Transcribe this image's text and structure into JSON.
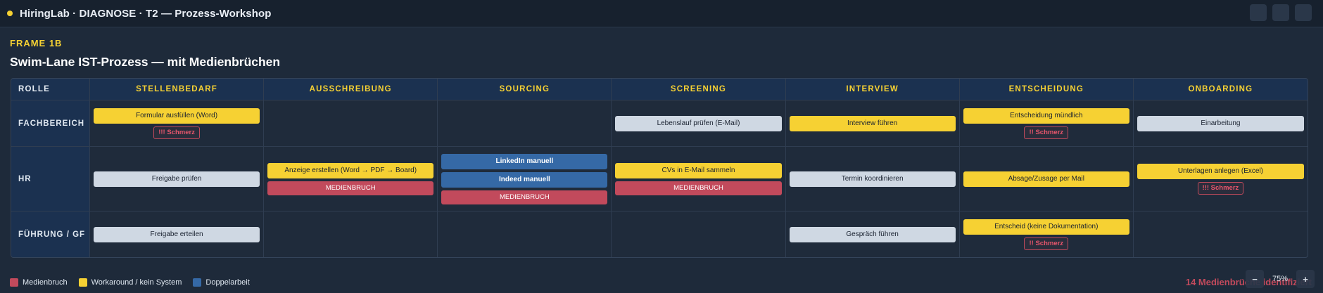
{
  "topbar": {
    "title": "HiringLab · DIAGNOSE · T2 — Prozess-Workshop",
    "accent_color": "#f6d133"
  },
  "frame": {
    "label": "FRAME 1B",
    "title": "Swim-Lane IST-Prozess — mit Medienbrüchen"
  },
  "table": {
    "role_header": "ROLLE",
    "phases": [
      "STELLENBEDARF",
      "AUSSCHREIBUNG",
      "SOURCING",
      "SCREENING",
      "INTERVIEW",
      "ENTSCHEIDUNG",
      "ONBOARDING"
    ],
    "lanes": [
      {
        "role": "FACHBEREICH",
        "cells": [
          [
            {
              "type": "yellow",
              "text": "Formular ausfüllen (Word)"
            },
            {
              "type": "pain",
              "text": "!!! Schmerz"
            }
          ],
          [],
          [],
          [
            {
              "type": "white",
              "text": "Lebenslauf prüfen (E-Mail)"
            }
          ],
          [
            {
              "type": "yellow",
              "text": "Interview führen"
            }
          ],
          [
            {
              "type": "yellow",
              "text": "Entscheidung mündlich"
            },
            {
              "type": "pain",
              "text": "!! Schmerz"
            }
          ],
          [
            {
              "type": "white",
              "text": "Einarbeitung"
            }
          ]
        ]
      },
      {
        "role": "HR",
        "cells": [
          [
            {
              "type": "white",
              "text": "Freigabe prüfen"
            }
          ],
          [
            {
              "type": "yellow",
              "text": "Anzeige erstellen (Word → PDF → Board)"
            },
            {
              "type": "red",
              "text": "MEDIENBRUCH"
            }
          ],
          [
            {
              "type": "blue",
              "text": "LinkedIn manuell"
            },
            {
              "type": "blue",
              "text": "Indeed manuell"
            },
            {
              "type": "red",
              "text": "MEDIENBRUCH"
            }
          ],
          [
            {
              "type": "yellow",
              "text": "CVs in E-Mail sammeln"
            },
            {
              "type": "red",
              "text": "MEDIENBRUCH"
            }
          ],
          [
            {
              "type": "white",
              "text": "Termin koordinieren"
            }
          ],
          [
            {
              "type": "yellow",
              "text": "Absage/Zusage per Mail"
            }
          ],
          [
            {
              "type": "yellow",
              "text": "Unterlagen anlegen (Excel)"
            },
            {
              "type": "pain",
              "text": "!!! Schmerz"
            }
          ]
        ]
      },
      {
        "role": "FÜHRUNG / GF",
        "cells": [
          [
            {
              "type": "white",
              "text": "Freigabe erteilen"
            }
          ],
          [],
          [],
          [],
          [
            {
              "type": "white",
              "text": "Gespräch führen"
            }
          ],
          [
            {
              "type": "yellow",
              "text": "Entscheid (keine Dokumentation)"
            },
            {
              "type": "pain",
              "text": "!! Schmerz"
            }
          ],
          []
        ]
      }
    ]
  },
  "legend": [
    {
      "label": "Medienbruch",
      "color": "#c24a5c"
    },
    {
      "label": "Workaround / kein System",
      "color": "#f6d133"
    },
    {
      "label": "Doppelarbeit",
      "color": "#3569a6"
    }
  ],
  "summary": "14 Medienbrüche identifiziert",
  "zoom": {
    "minus": "−",
    "value": "75%",
    "plus": "+"
  }
}
